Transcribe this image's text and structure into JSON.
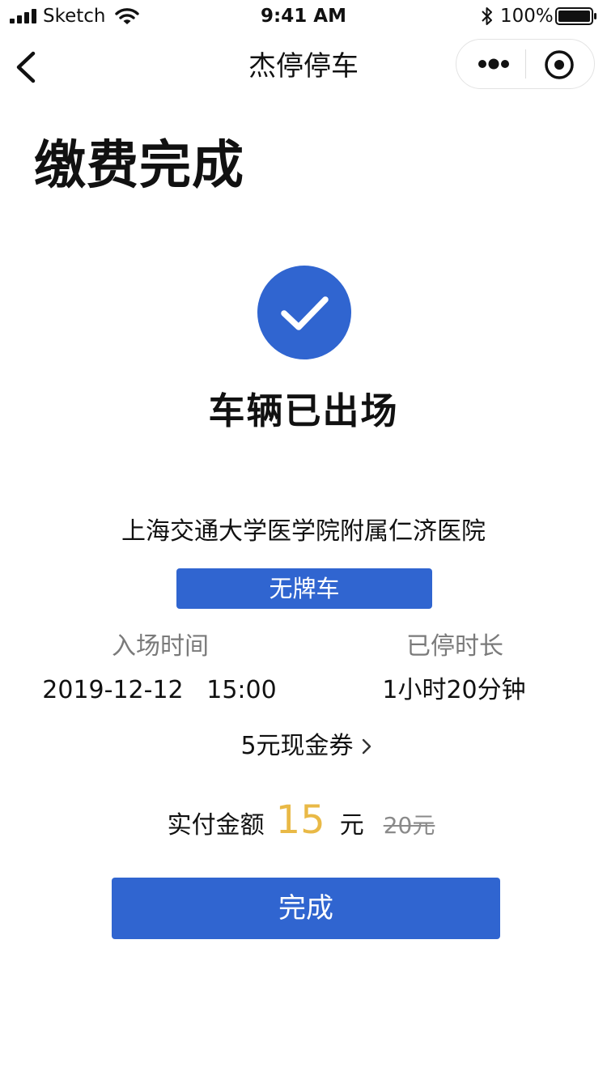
{
  "status_bar": {
    "carrier": "Sketch",
    "time": "9:41 AM",
    "battery_percent": "100%"
  },
  "nav": {
    "title": "杰停停车",
    "icons": [
      "back-icon",
      "more-icon",
      "target-icon"
    ]
  },
  "page": {
    "title": "缴费完成",
    "status": "车辆已出场",
    "status_icon": "check-circle-icon"
  },
  "parking": {
    "lot_name": "上海交通大学医学院附属仁济医院",
    "plate": "无牌车",
    "entry_time_label": "入场时间",
    "entry_time": "2019-12-12   15:00",
    "duration_label": "已停时长",
    "duration": "1小时20分钟"
  },
  "coupon": {
    "label": "5元现金券"
  },
  "payment": {
    "label": "实付金额",
    "amount": "15",
    "unit": "元",
    "original_price": "20元"
  },
  "actions": {
    "done_label": "完成"
  },
  "colors": {
    "primary": "#3065d0",
    "amount": "#e9b946",
    "muted": "#7a7a7a"
  }
}
